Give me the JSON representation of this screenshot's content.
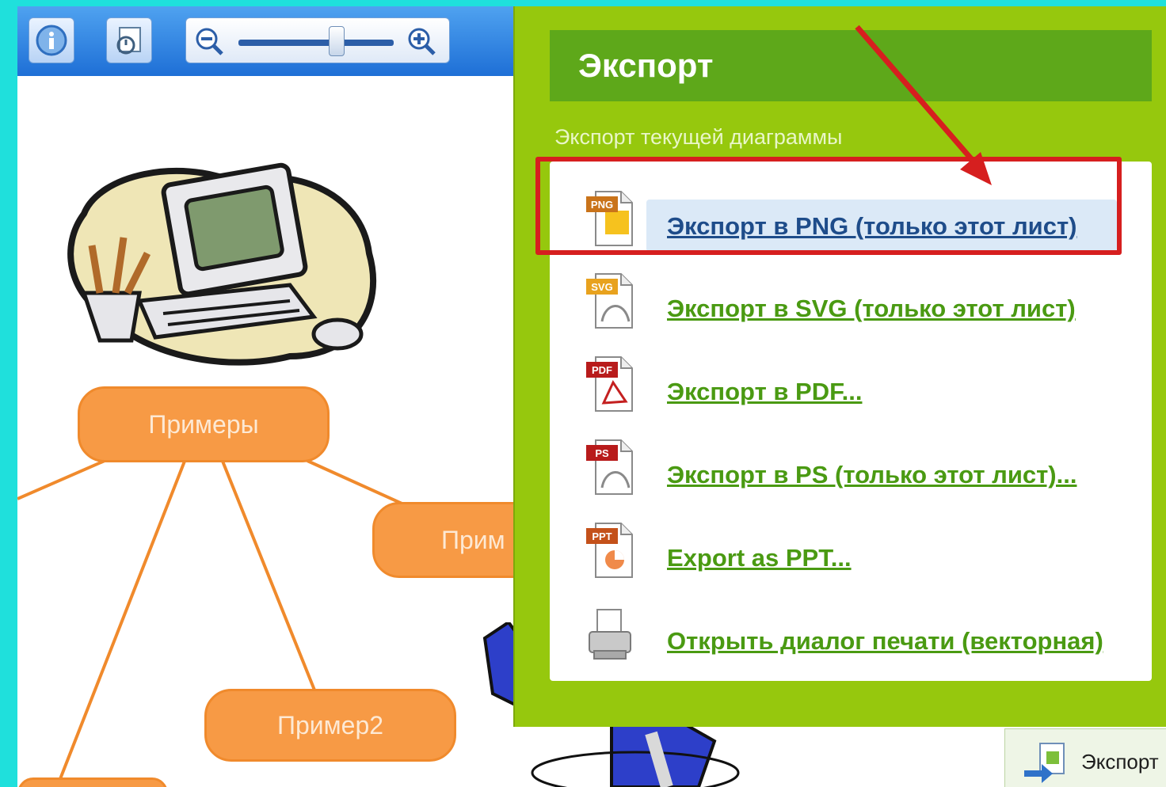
{
  "toolbar": {
    "info_icon": "info-icon",
    "rotate_icon": "rotate-icon",
    "zoom_out_icon": "zoom-out-icon",
    "zoom_in_icon": "zoom-in-icon",
    "zoom_level": 0.65
  },
  "mindmap": {
    "nodes": [
      "Примеры",
      "Прим",
      "Пример2"
    ]
  },
  "export_panel": {
    "title": "Экспорт",
    "subtitle": "Экспорт текущей диаграммы",
    "items": [
      {
        "label": "Экспорт в PNG (только этот лист)",
        "badge": "PNG",
        "badge_color": "#c9731a"
      },
      {
        "label": "Экспорт в SVG (только этот лист)",
        "badge": "SVG",
        "badge_color": "#e8a21e"
      },
      {
        "label": "Экспорт в PDF...",
        "badge": "PDF",
        "badge_color": "#b81b1b"
      },
      {
        "label": "Экспорт в PS (только этот лист)...",
        "badge": "PS",
        "badge_color": "#b81b1b"
      },
      {
        "label": "Export as PPT...",
        "badge": "PPT",
        "badge_color": "#c4511a"
      },
      {
        "label": "Открыть диалог печати (векторная)",
        "icon": "printer-icon"
      }
    ]
  },
  "bottom_bar": {
    "export_label": "Экспорт"
  },
  "colors": {
    "panel": "#96c80d",
    "header": "#5ea81a",
    "link": "#4a9a12",
    "highlight_border": "#d61f1f",
    "node": "#f79a45",
    "background": "#1fe0dc"
  }
}
